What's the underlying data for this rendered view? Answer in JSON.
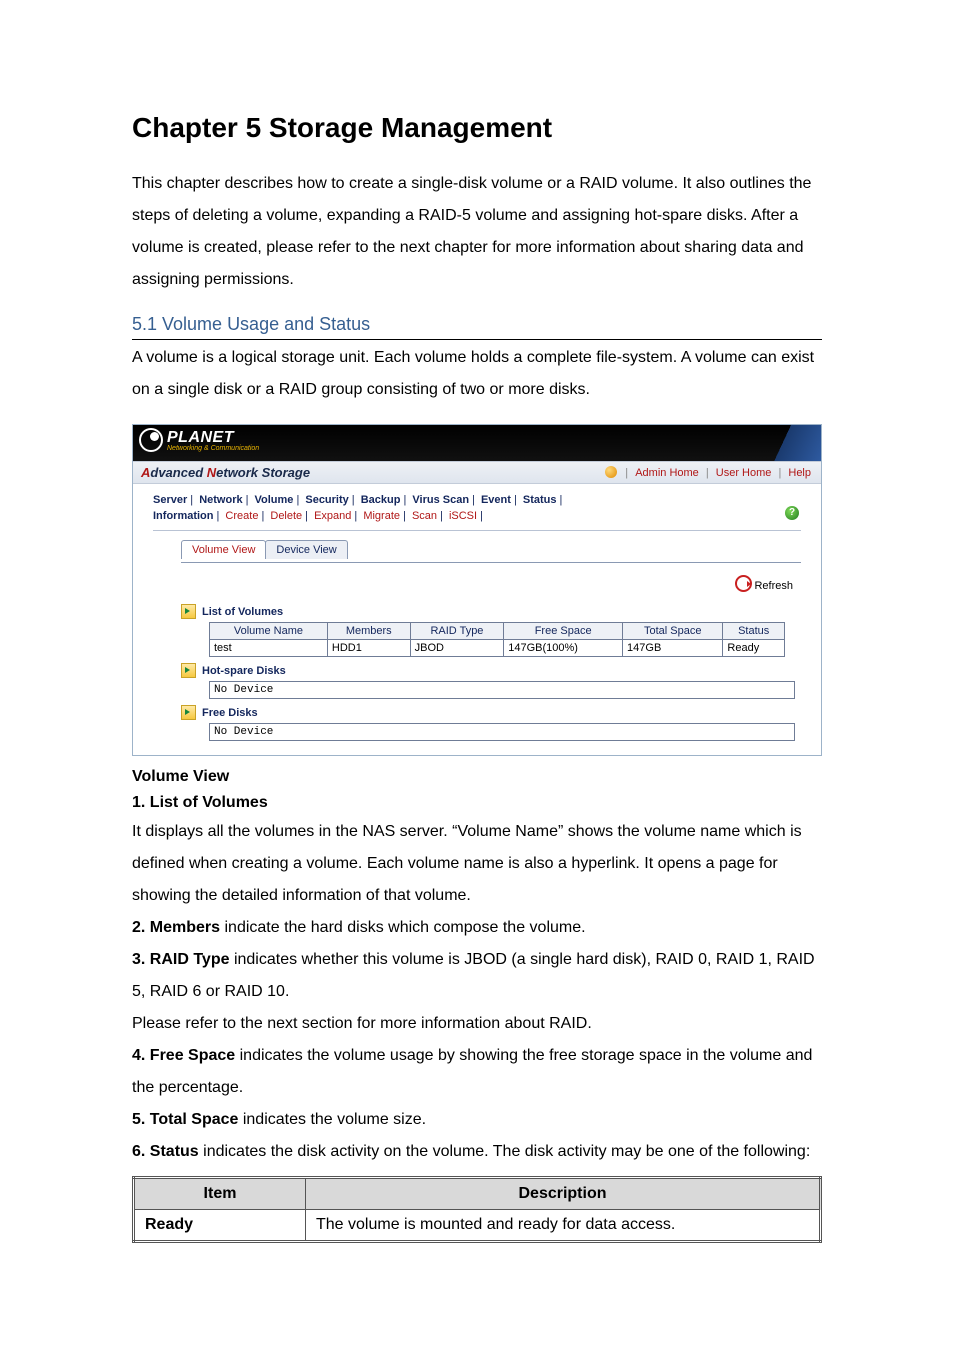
{
  "chapter_title": "Chapter 5 Storage Management",
  "intro": "This chapter describes how to create a single-disk volume or a RAID volume. It also outlines the steps of deleting a volume, expanding a RAID-5 volume and assigning hot-spare disks. After a volume is created, please refer to the next chapter for more information about sharing data and assigning permissions.",
  "section_heading": "5.1 Volume Usage and Status",
  "section_intro": "A volume is a logical storage unit. Each volume holds a complete file-system. A volume can exist on a single disk or a RAID group consisting of two or more disks.",
  "screenshot": {
    "brand": {
      "name": "PLANET",
      "tagline": "Networking & Communication"
    },
    "product": {
      "a": "A",
      "dvanced": "dvanced ",
      "n": "N",
      "etwork_storage": "etwork Storage"
    },
    "top_links": {
      "admin": "Admin Home",
      "user": "User Home",
      "help": "Help"
    },
    "nav_primary": [
      "Server",
      "Network",
      "Volume",
      "Security",
      "Backup",
      "Virus Scan",
      "Event",
      "Status"
    ],
    "nav_secondary": {
      "active": "Information",
      "rest": [
        "Create",
        "Delete",
        "Expand",
        "Migrate",
        "Scan",
        "iSCSI"
      ]
    },
    "tabs": {
      "active": "Volume View",
      "inactive": "Device View"
    },
    "refresh": "Refresh",
    "sections": {
      "volumes_title": "List of Volumes",
      "volumes_headers": [
        "Volume Name",
        "Members",
        "RAID Type",
        "Free Space",
        "Total Space",
        "Status"
      ],
      "volumes_rows": [
        {
          "name": "test",
          "members": "HDD1",
          "raid": "JBOD",
          "free": "147GB(100%)",
          "total": "147GB",
          "status": "Ready"
        }
      ],
      "hotspare_title": "Hot-spare Disks",
      "hotspare_rows": [
        "No Device"
      ],
      "free_title": "Free Disks",
      "free_rows": [
        "No Device"
      ]
    }
  },
  "volview_heading": "Volume View",
  "list_heading": "1. List of Volumes",
  "list_text": "It displays all the volumes in the NAS server. “Volume Name” shows the volume name which is defined when creating a volume. Each volume name is also a hyperlink. It opens a page for showing the detailed information of that volume.",
  "members_label": "2. Members",
  "members_text": " indicate the hard disks which compose the volume.",
  "raid_label": "3. RAID Type",
  "raid_text_a": " indicates whether this volume is JBOD (a single hard disk), RAID 0, RAID 1, RAID 5, RAID 6 or RAID 10.",
  "raid_text_b": "Please refer to the next section for more information about RAID.",
  "free_label": "4. Free Space",
  "free_text": " indicates the volume usage by showing the free storage space in the volume and the percentage.",
  "total_label": "5. Total Space",
  "total_text": " indicates the volume size.",
  "status_label": "6. Status",
  "status_text": " indicates the disk activity on the volume. The disk activity may be one of the following:",
  "status_table": {
    "headers": [
      "Item",
      "Description"
    ],
    "rows": [
      {
        "item": "Ready",
        "desc": "The volume is mounted and ready for data access."
      }
    ]
  }
}
